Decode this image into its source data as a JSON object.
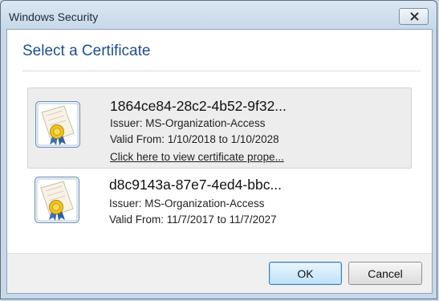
{
  "window": {
    "title": "Windows Security",
    "heading": "Select a Certificate"
  },
  "certificates": [
    {
      "name": "1864ce84-28c2-4b52-9f32...",
      "issuer": "Issuer: MS-Organization-Access",
      "valid": "Valid From: 1/10/2018 to 1/10/2028",
      "link": "Click here to view certificate prope...",
      "selected": true,
      "icon": "certificate-icon"
    },
    {
      "name": "d8c9143a-87e7-4ed4-bbc...",
      "issuer": "Issuer: MS-Organization-Access",
      "valid": "Valid From: 11/7/2017 to 11/7/2027",
      "selected": false,
      "icon": "certificate-icon"
    }
  ],
  "buttons": {
    "ok": "OK",
    "cancel": "Cancel"
  },
  "colors": {
    "heading": "#1e4e8c",
    "ok_border": "#3c7fb1"
  }
}
